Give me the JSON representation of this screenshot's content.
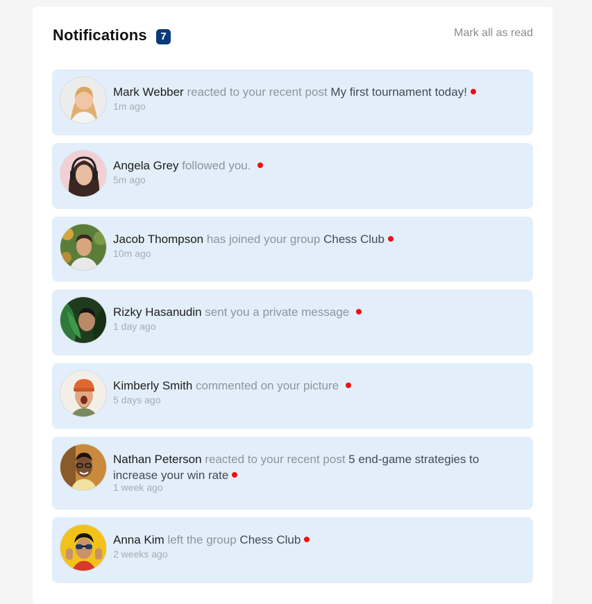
{
  "header": {
    "title": "Notifications",
    "unread_count": "7",
    "mark_all_label": "Mark all as read"
  },
  "notifications": [
    {
      "name": "Mark Webber",
      "action": "reacted to your recent post",
      "target": "My first tournament today!",
      "time": "1m ago",
      "unread": true
    },
    {
      "name": "Angela Grey",
      "action": "followed you.",
      "target": "",
      "time": "5m ago",
      "unread": true
    },
    {
      "name": "Jacob Thompson",
      "action": "has joined your group",
      "target": "Chess Club",
      "time": "10m ago",
      "unread": true
    },
    {
      "name": "Rizky Hasanudin",
      "action": "sent you a private message",
      "target": "",
      "time": "1 day ago",
      "unread": true
    },
    {
      "name": "Kimberly Smith",
      "action": "commented on your picture",
      "target": "",
      "time": "5 days ago",
      "unread": true
    },
    {
      "name": "Nathan Peterson",
      "action": "reacted to your recent post",
      "target": "5 end-game strategies to increase your win rate",
      "time": "1 week ago",
      "unread": true
    },
    {
      "name": "Anna Kim",
      "action": "left the group",
      "target": "Chess Club",
      "time": "2 weeks ago",
      "unread": true
    }
  ],
  "colors": {
    "badge": "#0b3a7a",
    "item_background": "#e2effa",
    "unread_dot": "#ee1111"
  }
}
